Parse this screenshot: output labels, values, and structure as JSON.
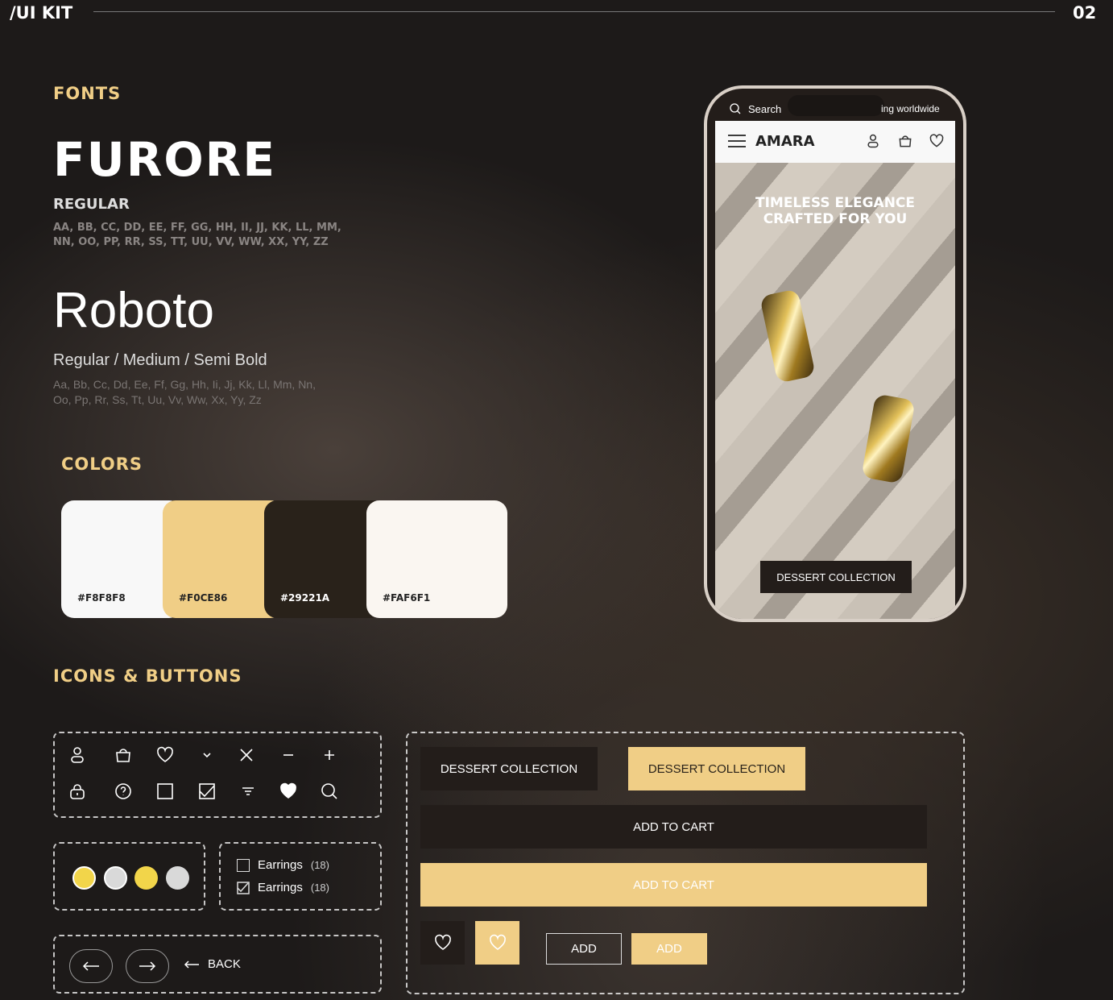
{
  "header": {
    "title": "/UI KIT",
    "page": "02"
  },
  "fonts": {
    "section": "FONTS",
    "font1": {
      "name": "FURORE",
      "weight": "REGULAR",
      "sample1": "AA, BB, CC, DD, EE, FF, GG, HH, II, JJ, KK, LL, MM,",
      "sample2": "NN, OO, PP, RR, SS, TT, UU, VV, WW, XX, YY, ZZ"
    },
    "font2": {
      "name": "Roboto",
      "weights": "Regular / Medium / Semi Bold",
      "sample1": "Aa, Bb, Cc, Dd, Ee, Ff, Gg, Hh, Ii, Jj, Kk, Ll, Mm, Nn,",
      "sample2": "Oo, Pp, Rr, Ss, Tt, Uu, Vv, Ww, Xx, Yy, Zz"
    }
  },
  "colors": {
    "section": "COLORS",
    "swatches": [
      {
        "hex": "#F8F8F8"
      },
      {
        "hex": "#F0CE86"
      },
      {
        "hex": "#29221A"
      },
      {
        "hex": "#FAF6F1"
      }
    ]
  },
  "icons": {
    "section": "ICONS & BUTTONS",
    "row1": [
      "user-icon",
      "bag-icon",
      "heart-icon",
      "chevron-down-icon",
      "close-icon",
      "minus-icon",
      "plus-icon"
    ],
    "row2": [
      "lock-icon",
      "help-icon",
      "checkbox-empty-icon",
      "checkbox-checked-icon",
      "filter-icon",
      "heart-filled-icon",
      "search-icon"
    ]
  },
  "dots": [
    "#f2d54a",
    "#d9d9d9",
    "#f2d54a",
    "#d9d9d9"
  ],
  "filters": [
    {
      "label": "Earrings",
      "count": "(18)",
      "checked": false
    },
    {
      "label": "Earrings",
      "count": "(18)",
      "checked": true
    }
  ],
  "nav": {
    "back": "BACK"
  },
  "buttons": {
    "dessert_dark": "DESSERT COLLECTION",
    "dessert_gold": "DESSERT COLLECTION",
    "cart_dark": "ADD TO CART",
    "cart_gold": "ADD TO CART",
    "add_outline": "ADD",
    "add_gold": "ADD"
  },
  "phone": {
    "search": "Search",
    "shipping": "ing worldwide",
    "brand": "AMARA",
    "hero1": "TIMELESS ELEGANCE",
    "hero2": "CRAFTED FOR YOU",
    "cta": "DESSERT COLLECTION"
  }
}
